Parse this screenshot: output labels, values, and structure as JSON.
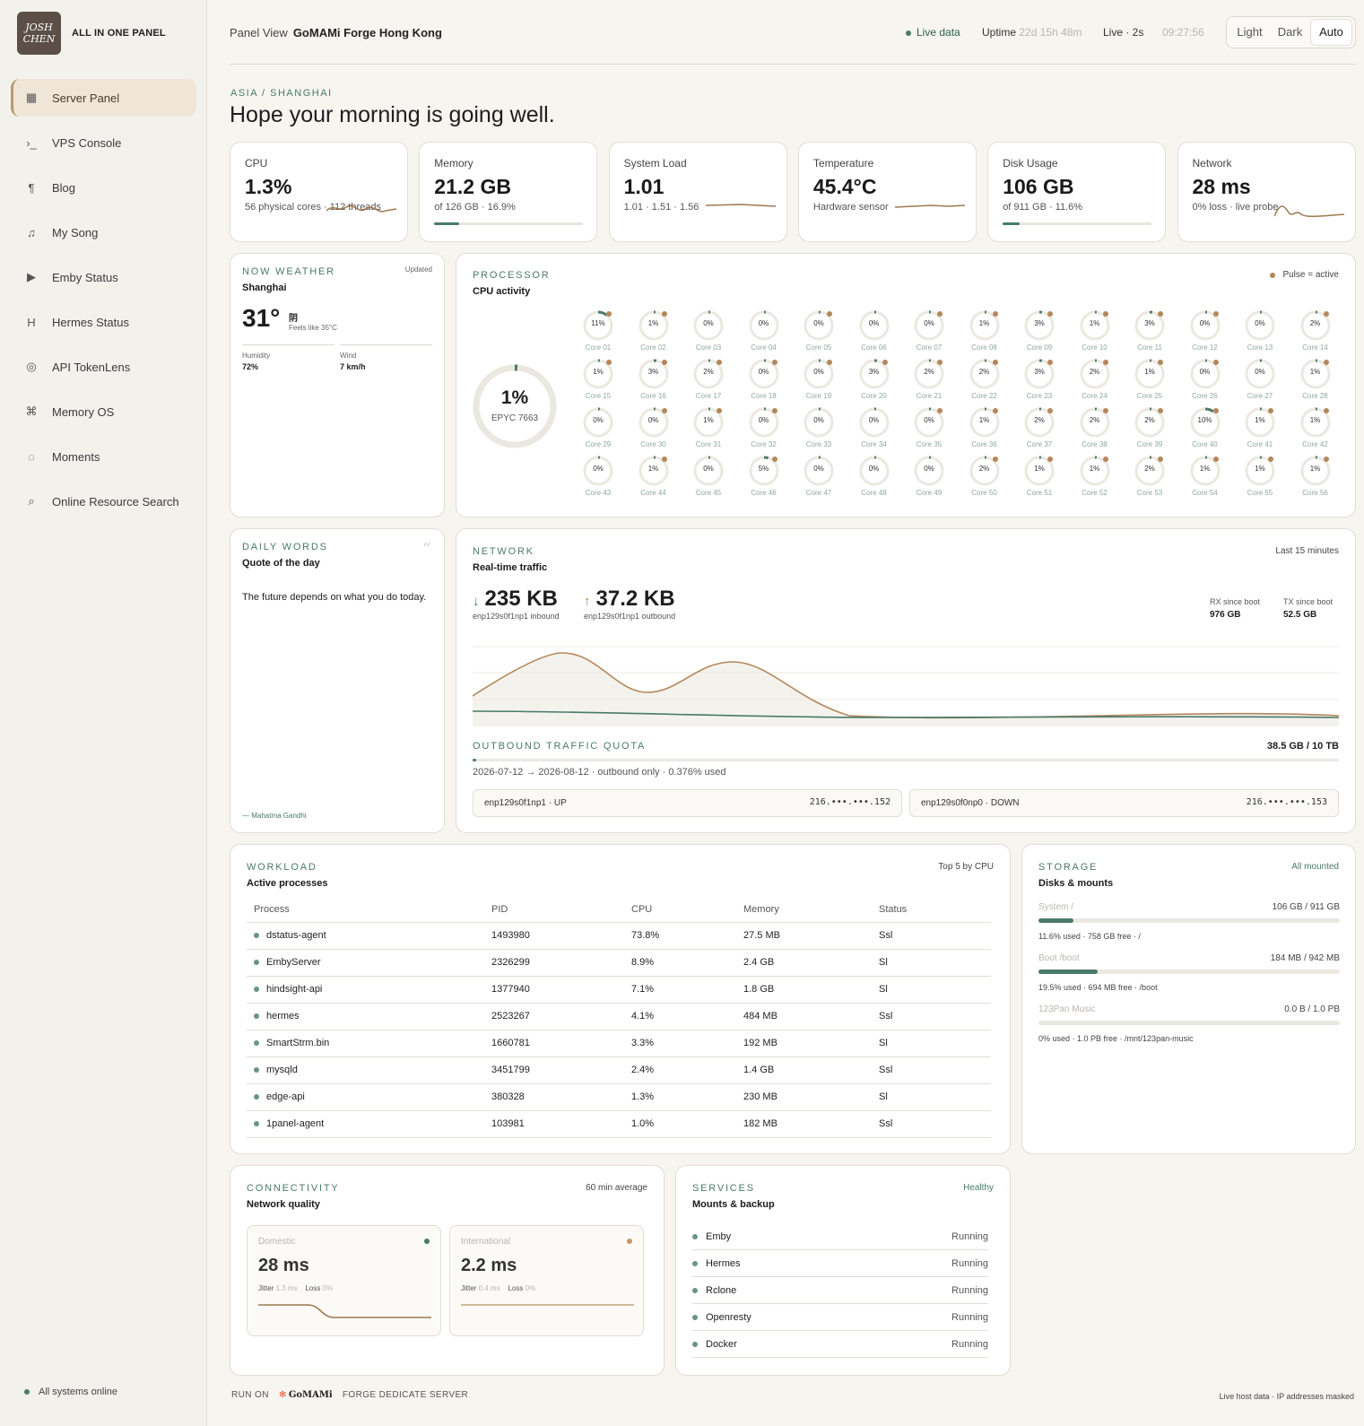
{
  "brand": {
    "logo_text": "JOSH CHEN",
    "name": "ALL IN ONE PANEL"
  },
  "nav": [
    {
      "label": "Server Panel",
      "icon": "▦",
      "active": true
    },
    {
      "label": "VPS Console",
      "icon": "›_"
    },
    {
      "label": "Blog",
      "icon": "¶"
    },
    {
      "label": "My Song",
      "icon": "♫"
    },
    {
      "label": "Emby Status",
      "icon": "▶"
    },
    {
      "label": "Hermes Status",
      "icon": "H"
    },
    {
      "label": "API TokenLens",
      "icon": "◎"
    },
    {
      "label": "Memory OS",
      "icon": "⌘"
    },
    {
      "label": "Moments",
      "icon": "◌"
    },
    {
      "label": "Online Resource Search",
      "icon": "⌕"
    }
  ],
  "sidebar_status": "All systems online",
  "header": {
    "panel_view": "Panel View",
    "server": "GoMAMi Forge Hong Kong",
    "live": "Live data",
    "uptime_label": "Uptime",
    "uptime": "22d 15h 48m",
    "live_interval": "Live · 2s",
    "time": "09:27:56",
    "themes": [
      "Light",
      "Dark",
      "Auto"
    ]
  },
  "region": "ASIA / SHANGHAI",
  "greeting": "Hope your morning is going well.",
  "stats": [
    {
      "label": "CPU",
      "value": "1.3%",
      "sub": "56 physical cores · 112 threads"
    },
    {
      "label": "Memory",
      "value": "21.2 GB",
      "sub": "of 126 GB · 16.9%",
      "fill": 0.169
    },
    {
      "label": "System Load",
      "value": "1.01",
      "sub": "1.01 · 1.51 · 1.56"
    },
    {
      "label": "Temperature",
      "value": "45.4°C",
      "sub": "Hardware sensor"
    },
    {
      "label": "Disk Usage",
      "value": "106 GB",
      "sub": "of 911 GB · 11.6%",
      "fill": 0.116
    },
    {
      "label": "Network",
      "value": "28 ms",
      "sub": "0% loss · live probe"
    }
  ],
  "weather": {
    "section": "NOW WEATHER",
    "updated": "Updated",
    "city": "Shanghai",
    "temp": "31°",
    "cond": "阴",
    "feels": "Feels like 35°C",
    "humidity_label": "Humidity",
    "humidity": "72%",
    "wind_label": "Wind",
    "wind": "7 km/h"
  },
  "processor": {
    "section": "PROCESSOR",
    "title": "CPU activity",
    "legend": "Pulse = active",
    "total": "1%",
    "model": "EPYC 7663",
    "cores": [
      11,
      1,
      0,
      0,
      0,
      0,
      0,
      1,
      3,
      1,
      3,
      0,
      0,
      2,
      1,
      3,
      2,
      0,
      0,
      3,
      2,
      2,
      3,
      2,
      1,
      0,
      0,
      1,
      0,
      0,
      1,
      0,
      0,
      0,
      0,
      1,
      2,
      2,
      2,
      10,
      1,
      1,
      0,
      1,
      0,
      5,
      0,
      0,
      0,
      2,
      1,
      1,
      2,
      1,
      1,
      1
    ],
    "active": [
      1,
      1,
      0,
      0,
      1,
      0,
      1,
      1,
      1,
      1,
      1,
      1,
      0,
      1,
      1,
      1,
      1,
      1,
      1,
      1,
      1,
      1,
      1,
      1,
      1,
      1,
      0,
      1,
      0,
      1,
      1,
      1,
      0,
      0,
      1,
      1,
      1,
      1,
      1,
      1,
      1,
      1,
      0,
      1,
      0,
      1,
      0,
      0,
      0,
      1,
      1,
      1,
      1,
      1,
      1,
      1
    ]
  },
  "quote": {
    "section": "DAILY WORDS",
    "title": "Quote of the day",
    "text": "The future depends on what you do today.",
    "author": "— Mahatma Gandhi"
  },
  "network": {
    "section": "NETWORK",
    "title": "Real-time traffic",
    "window": "Last 15 minutes",
    "in_value": "235 KB",
    "in_label": "enp129s0f1np1 inbound",
    "out_value": "37.2 KB",
    "out_label": "enp129s0f1np1 outbound",
    "rx_label": "RX since boot",
    "rx": "976 GB",
    "tx_label": "TX since boot",
    "tx": "52.5 GB",
    "quota_section": "OUTBOUND TRAFFIC QUOTA",
    "quota_value": "38.5 GB / 10 TB",
    "quota_note": "2026-07-12 → 2026-08-12 · outbound only · 0.376% used",
    "quota_fill": 0.00376,
    "if1_name": "enp129s0f1np1 · UP",
    "if1_ip": "216.•••.•••.152",
    "if2_name": "enp129s0f0np0 · DOWN",
    "if2_ip": "216.•••.•••.153"
  },
  "workload": {
    "section": "WORKLOAD",
    "title": "Active processes",
    "note": "Top 5 by CPU",
    "columns": [
      "Process",
      "PID",
      "CPU",
      "Memory",
      "Status"
    ],
    "rows": [
      [
        "dstatus-agent",
        "1493980",
        "73.8%",
        "27.5 MB",
        "Ssl"
      ],
      [
        "EmbyServer",
        "2326299",
        "8.9%",
        "2.4 GB",
        "Sl"
      ],
      [
        "hindsight-api",
        "1377940",
        "7.1%",
        "1.8 GB",
        "Sl"
      ],
      [
        "hermes",
        "2523267",
        "4.1%",
        "484 MB",
        "Ssl"
      ],
      [
        "SmartStrm.bin",
        "1660781",
        "3.3%",
        "192 MB",
        "Sl"
      ],
      [
        "mysqld",
        "3451799",
        "2.4%",
        "1.4 GB",
        "Ssl"
      ],
      [
        "edge-api",
        "380328",
        "1.3%",
        "230 MB",
        "Sl"
      ],
      [
        "1panel-agent",
        "103981",
        "1.0%",
        "182 MB",
        "Ssl"
      ]
    ]
  },
  "storage": {
    "section": "STORAGE",
    "title": "Disks & mounts",
    "note": "All mounted",
    "disks": [
      {
        "name": "System /",
        "size": "106 GB / 911 GB",
        "sub": "11.6% used · 758 GB free · /",
        "fill": 0.116
      },
      {
        "name": "Boot /boot",
        "size": "184 MB / 942 MB",
        "sub": "19.5% used · 694 MB free · /boot",
        "fill": 0.195
      },
      {
        "name": "123Pan Music",
        "size": "0.0 B / 1.0 PB",
        "sub": "0% used · 1.0 PB free · /mnt/123pan-music",
        "fill": 0
      }
    ]
  },
  "connectivity": {
    "section": "CONNECTIVITY",
    "title": "Network quality",
    "note": "60 min average",
    "domestic": {
      "label": "Domestic",
      "value": "28 ms",
      "jitter_label": "Jitter",
      "jitter": "1.3 ms",
      "loss_label": "Loss",
      "loss": "0%"
    },
    "intl": {
      "label": "International",
      "value": "2.2 ms",
      "jitter_label": "Jitter",
      "jitter": "0.4 ms",
      "loss_label": "Loss",
      "loss": "0%"
    }
  },
  "services": {
    "section": "SERVICES",
    "title": "Mounts & backup",
    "note": "Healthy",
    "items": [
      [
        "Emby",
        "Running"
      ],
      [
        "Hermes",
        "Running"
      ],
      [
        "Rclone",
        "Running"
      ],
      [
        "Openresty",
        "Running"
      ],
      [
        "Docker",
        "Running"
      ]
    ]
  },
  "footer": {
    "run_on": "RUN ON",
    "brand": "GoMAMi",
    "server": "FORGE DEDICATE SERVER",
    "note": "Live host data · IP addresses masked"
  },
  "colors": {
    "accent": "#4a7a6a",
    "warm": "#b89a6e",
    "bg": "#f7f5f0"
  }
}
